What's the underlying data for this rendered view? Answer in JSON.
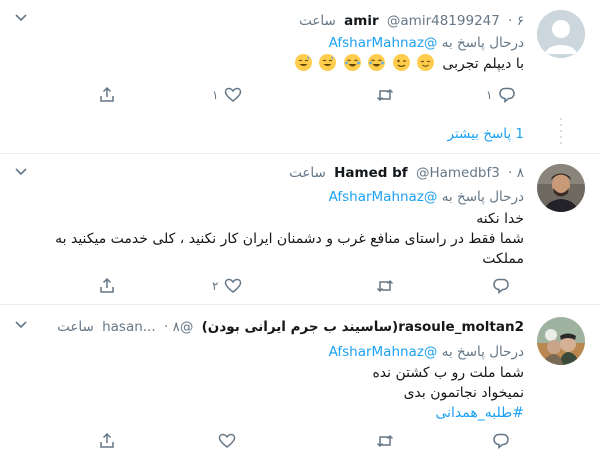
{
  "tweets": [
    {
      "name": "amir",
      "handle": "@amir48199247",
      "dot": "·",
      "time": "۶ ساعت",
      "replying_prefix": "درحال پاسخ به",
      "replying_mention": "@AfsharMahnaz",
      "body_text": "با دیپلم تجربی",
      "emoji_icons": [
        "relieved-face-icon",
        "winking-face-icon",
        "face-with-tears-of-joy-icon",
        "face-with-tears-of-joy-icon",
        "grinning-sweat-face-icon",
        "grinning-sweat-face-icon"
      ],
      "reply_count": "۱",
      "retweet_count": "",
      "like_count": "۱",
      "show_more": "1 پاسخ بیشتر"
    },
    {
      "name": "Hamed bf",
      "handle": "@Hamedbf3",
      "dot": "·",
      "time": "۸ ساعت",
      "replying_prefix": "درحال پاسخ به",
      "replying_mention": "@AfsharMahnaz",
      "body_lines": [
        "خدا نکنه",
        "شما فقط در راستای منافع غرب و دشمنان ایران کار نکنید ، کلی خدمت میکنید به",
        "مملکت"
      ],
      "reply_count": "",
      "retweet_count": "",
      "like_count": "۲"
    },
    {
      "name": "rasoule_moltan2(ساسیند ب جرم ایرانی بودن)",
      "handle": "@hasan...",
      "dot": "·",
      "time": "۸ ساعت",
      "replying_prefix": "درحال پاسخ به",
      "replying_mention": "@AfsharMahnaz",
      "body_lines": [
        "شما ملت رو ب کشتن نده",
        "نمیخواد نجاتمون بدی"
      ],
      "hashtag": "#طلبه_همدانی",
      "reply_count": "",
      "retweet_count": "",
      "like_count": ""
    }
  ],
  "colors": {
    "link": "#1da1f2",
    "muted": "#657786",
    "divider": "#e6ecf0",
    "text": "#14171a"
  }
}
